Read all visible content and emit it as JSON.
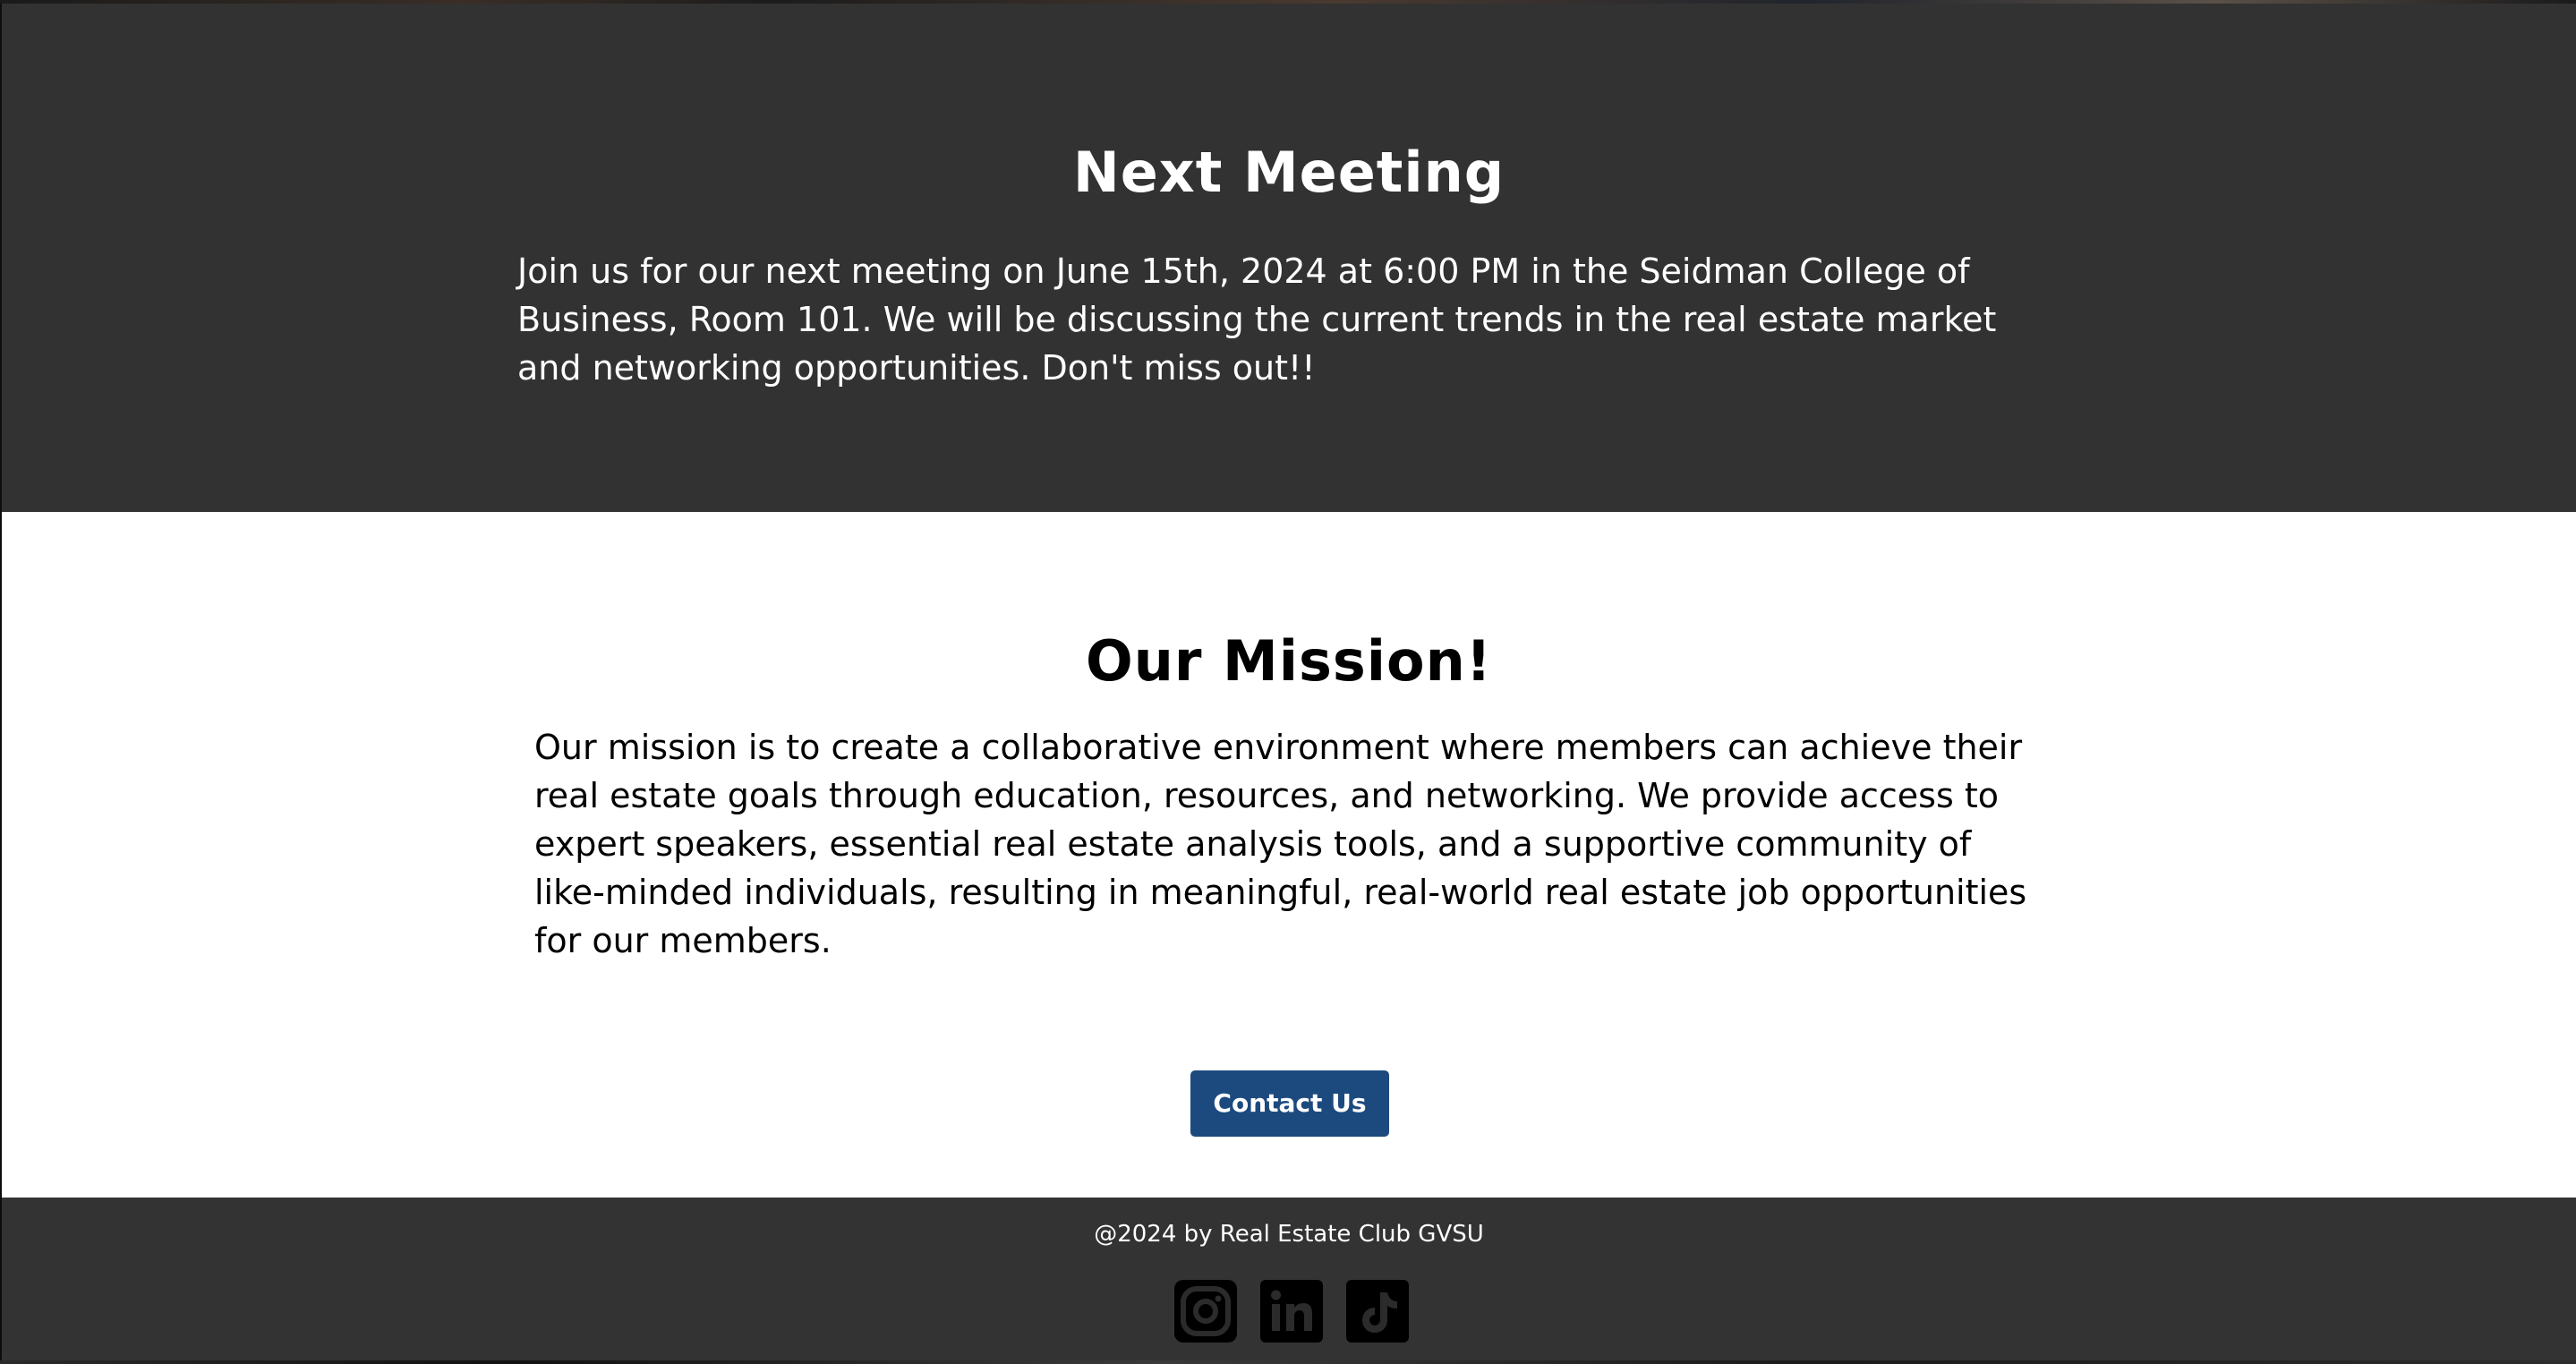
{
  "meeting": {
    "title": "Next Meeting",
    "description": "Join us for our next meeting on June 15th, 2024 at 6:00 PM in the Seidman College of Business, Room 101. We will be discussing the current trends in the real estate market and networking opportunities. Don't miss out!!",
    "background_color": "#323232"
  },
  "mission": {
    "title": "Our Mission!",
    "description": "Our mission is to create a collaborative environment where members can achieve their real estate goals through education, resources, and networking. We provide access to expert speakers, essential real estate analysis tools, and a supportive community of like-minded individuals, resulting in meaningful, real-world real estate job opportunities for our members.",
    "contact_button_label": "Contact Us",
    "button_color": "#1d4a7e"
  },
  "footer": {
    "copyright": "@2024 by Real Estate Club GVSU",
    "social_links": [
      {
        "icon": "instagram-icon"
      },
      {
        "icon": "linkedin-icon"
      },
      {
        "icon": "tiktok-icon"
      }
    ]
  }
}
